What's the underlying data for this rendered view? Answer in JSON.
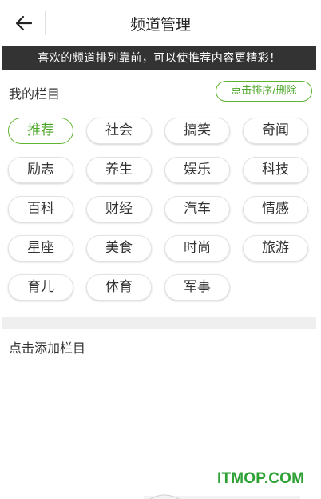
{
  "header": {
    "title": "频道管理"
  },
  "banner": {
    "text": "喜欢的频道排列靠前，可以使推荐内容更精彩！"
  },
  "my_channels": {
    "title": "我的栏目",
    "sort_button": "点击排序/删除",
    "selected_index": 0,
    "items": [
      "推荐",
      "社会",
      "搞笑",
      "奇闻",
      "励志",
      "养生",
      "娱乐",
      "科技",
      "百科",
      "财经",
      "汽车",
      "情感",
      "星座",
      "美食",
      "时尚",
      "旅游",
      "育儿",
      "体育",
      "军事"
    ]
  },
  "add_section": {
    "title": "点击添加栏目"
  },
  "watermark": {
    "text": "ITMOP.COM"
  },
  "colors": {
    "accent": "#4aa626",
    "banner_bg": "#333333",
    "watermark": "#2ea135"
  },
  "icons": {
    "back": "back-arrow-icon"
  }
}
